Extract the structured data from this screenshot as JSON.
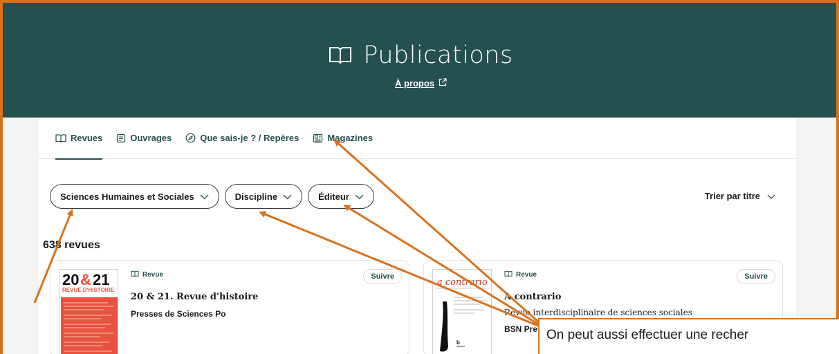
{
  "header": {
    "title": "Publications",
    "about_link": "À propos",
    "book_icon": "book-open-icon",
    "external_icon": "external-link-icon"
  },
  "tabs": [
    {
      "label": "Revues",
      "icon": "book-open-icon",
      "active": true
    },
    {
      "label": "Ouvrages",
      "icon": "document-icon",
      "active": false
    },
    {
      "label": "Que sais-je ? / Repères",
      "icon": "compass-icon",
      "active": false
    },
    {
      "label": "Magazines",
      "icon": "newspaper-icon",
      "active": false
    }
  ],
  "filters": [
    {
      "label": "Sciences Humaines et Sociales"
    },
    {
      "label": "Discipline"
    },
    {
      "label": "Éditeur"
    }
  ],
  "sort": {
    "label": "Trier par titre"
  },
  "results": {
    "count_label": "638 revues"
  },
  "cards": [
    {
      "type": "Revue",
      "title": "20 & 21. Revue d'histoire",
      "subtitle": "",
      "publisher": "Presses de Sciences Po",
      "follow": "Suivre",
      "cover_text": "20&21",
      "cover_sub": "REVUE D'HISTOIRE"
    },
    {
      "type": "Revue",
      "title": "A contrario",
      "subtitle": "Revue interdisciplinaire de sciences sociales",
      "publisher": "BSN Press",
      "follow": "Suivre",
      "cover_text": "a contrario"
    }
  ],
  "annotation": {
    "callout_text": "On peut aussi effectuer une recher",
    "accent": "#d9711c"
  },
  "colors": {
    "header_bg": "#24504d",
    "accent": "#24504d",
    "annotation": "#d9711c",
    "cover_red": "#e8533f"
  }
}
